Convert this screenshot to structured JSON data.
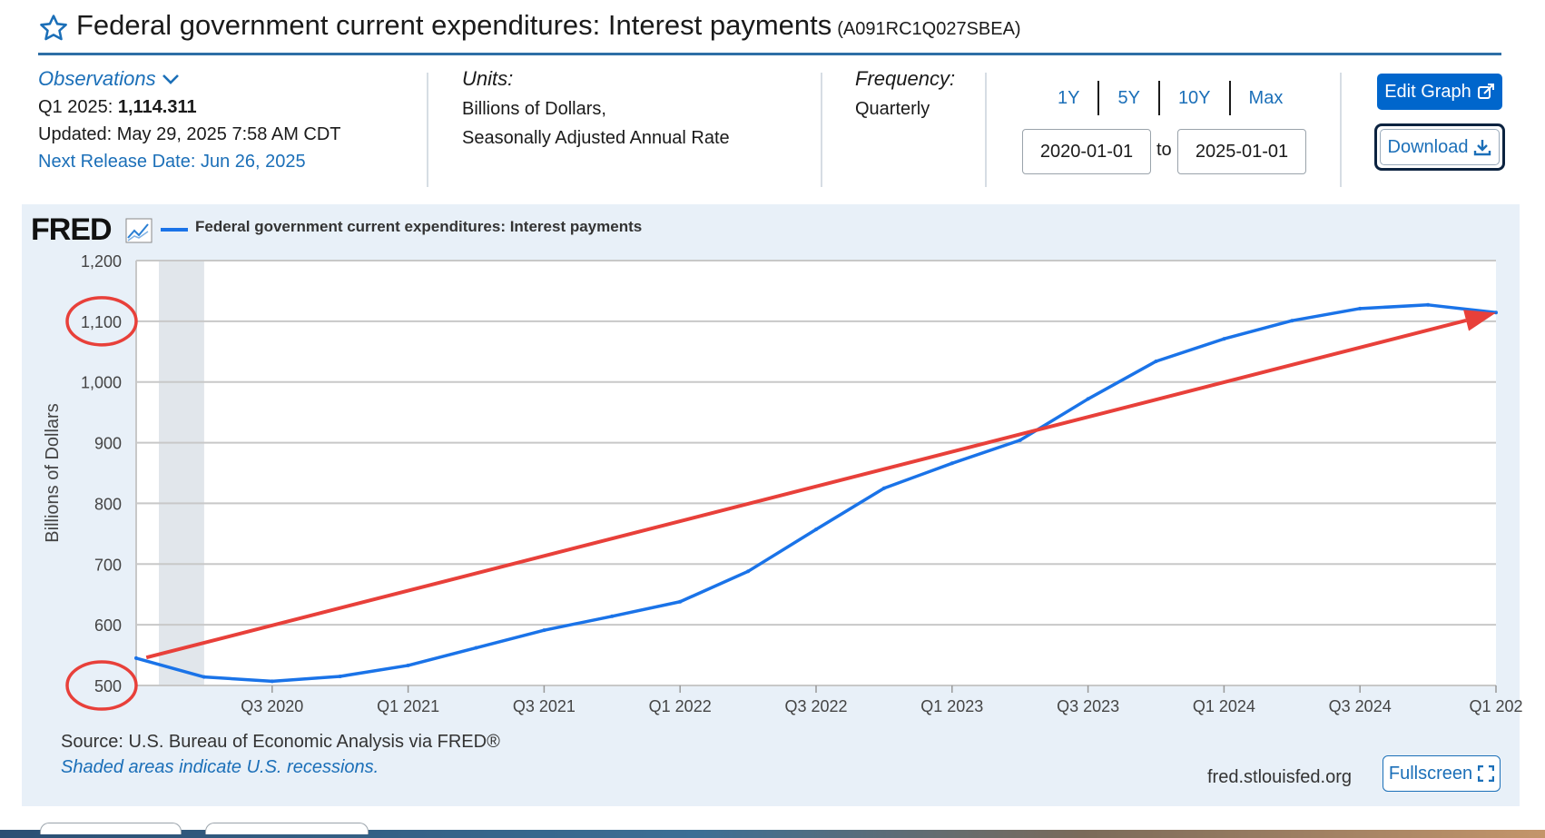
{
  "header": {
    "title": "Federal government current expenditures: Interest payments",
    "series_id": "(A091RC1Q027SBEA)"
  },
  "observations": {
    "link_label": "Observations",
    "period_label": "Q1 2025:",
    "period_value": "1,114.311",
    "updated": "Updated: May 29, 2025 7:58 AM CDT",
    "next_release": "Next Release Date: Jun 26, 2025"
  },
  "units": {
    "label": "Units:",
    "line1": "Billions of Dollars,",
    "line2": "Seasonally Adjusted Annual Rate"
  },
  "frequency": {
    "label": "Frequency:",
    "value": "Quarterly"
  },
  "range_buttons": [
    "1Y",
    "5Y",
    "10Y",
    "Max"
  ],
  "date_range": {
    "start": "2020-01-01",
    "to_label": "to",
    "end": "2025-01-01"
  },
  "buttons": {
    "edit_graph": "Edit Graph",
    "download": "Download",
    "fullscreen": "Fullscreen"
  },
  "brand": {
    "logo": "FRED",
    "site": "fred.stlouisfed.org"
  },
  "footer": {
    "source": "Source: U.S. Bureau of Economic Analysis via FRED®",
    "shaded_note": "Shaded areas indicate U.S. recessions."
  },
  "colors": {
    "series": "#1a73e8",
    "annotation": "#e8403a",
    "accent": "#0066cc",
    "recession_shade": "#e1e6eb"
  },
  "chart_data": {
    "type": "line",
    "legend": "Federal government current expenditures: Interest payments",
    "ylabel": "Billions of Dollars",
    "ylim": [
      500,
      1200
    ],
    "yticks": [
      500,
      600,
      700,
      800,
      900,
      1000,
      1100,
      1200
    ],
    "ytick_labels": [
      "500",
      "600",
      "700",
      "800",
      "900",
      "1,000",
      "1,100",
      "1,200"
    ],
    "xtick_labels": [
      "Q3 2020",
      "Q1 2021",
      "Q3 2021",
      "Q1 2022",
      "Q3 2022",
      "Q1 2023",
      "Q3 2023",
      "Q1 2024",
      "Q3 2024",
      "Q1 202"
    ],
    "xtick_index": [
      2,
      4,
      6,
      8,
      10,
      12,
      14,
      16,
      18,
      20
    ],
    "recession": {
      "start_index": 0,
      "end_index": 1
    },
    "series": [
      {
        "name": "Federal government current expenditures: Interest payments",
        "x": [
          "Q1 2020",
          "Q2 2020",
          "Q3 2020",
          "Q4 2020",
          "Q1 2021",
          "Q2 2021",
          "Q3 2021",
          "Q4 2021",
          "Q1 2022",
          "Q2 2022",
          "Q3 2022",
          "Q4 2022",
          "Q1 2023",
          "Q2 2023",
          "Q3 2023",
          "Q4 2023",
          "Q1 2024",
          "Q2 2024",
          "Q3 2024",
          "Q4 2024",
          "Q1 2025"
        ],
        "values": [
          545,
          514,
          507,
          515,
          533,
          562,
          591,
          614,
          638,
          688,
          757,
          825,
          866,
          904,
          972,
          1034,
          1071,
          1101,
          1121,
          1127,
          1114.311
        ]
      }
    ],
    "annotations": {
      "trend_arrow": {
        "from": {
          "index": 0.15,
          "value": 546
        },
        "to": {
          "index": 20,
          "value": 1114
        }
      },
      "circled_ticks": [
        1100,
        500
      ]
    }
  }
}
